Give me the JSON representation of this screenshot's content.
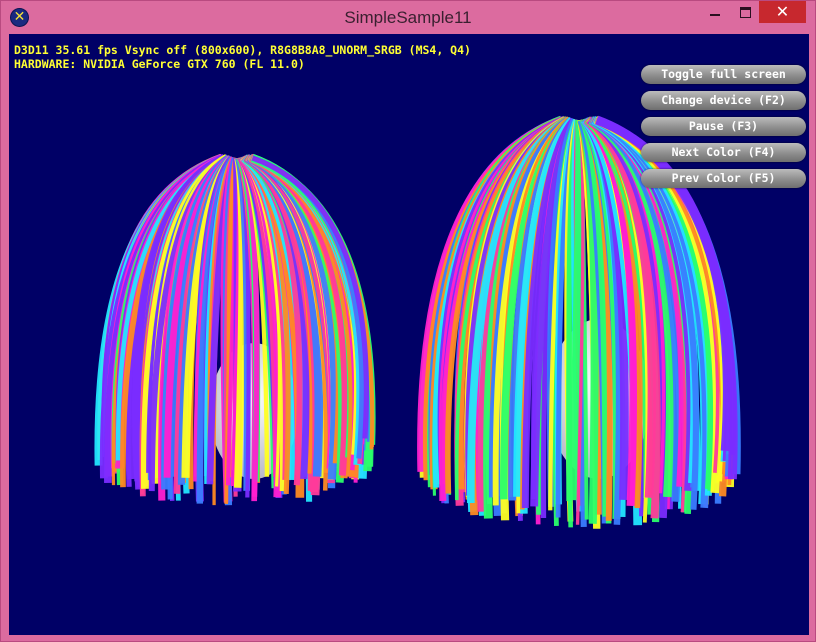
{
  "window": {
    "title": "SimpleSample11",
    "close_glyph": "✕"
  },
  "app_icon_glyph": "✕",
  "stats": {
    "line1": "D3D11 35.61 fps Vsync off (800x600), R8G8B8A8_UNORM_SRGB (MS4, Q4)",
    "line2": "HARDWARE: NVIDIA GeForce GTX 760 (FL 11.0)"
  },
  "hud_buttons": [
    {
      "label": "Toggle full screen"
    },
    {
      "label": "Change device (F2)"
    },
    {
      "label": "Pause (F3)"
    },
    {
      "label": "Next Color (F4)"
    },
    {
      "label": "Prev Color (F5)"
    }
  ],
  "colors": {
    "viewport_bg": "#000066",
    "stats_text": "#ffff33",
    "hair_palette": [
      "#ff1fd0",
      "#22e6ff",
      "#ffff22",
      "#7a2cff",
      "#ff8a22",
      "#2aff6a",
      "#3a7cff",
      "#ff3a9a"
    ]
  },
  "icons": {
    "app": "dx-sample-icon",
    "minimize": "minimize-icon",
    "maximize": "maximize-icon",
    "close": "close-icon"
  }
}
